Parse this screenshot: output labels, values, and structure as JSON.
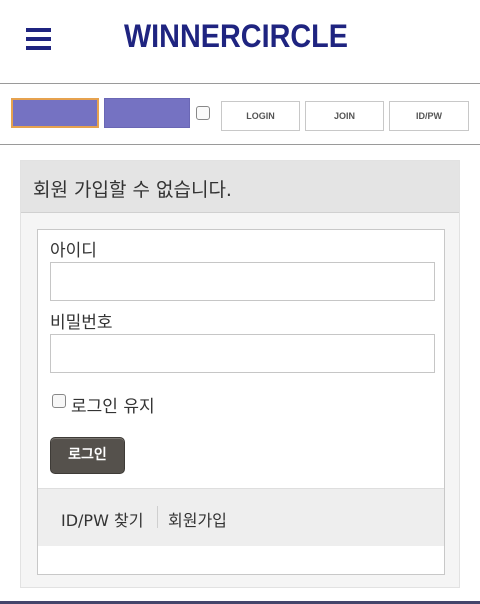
{
  "header": {
    "logo": "WINNERCIRCLE",
    "menu_icon": "hamburger-menu-icon"
  },
  "login_bar": {
    "id_input_placeholder": "",
    "pw_input_placeholder": "",
    "login_label": "LOGIN",
    "join_label": "JOIN",
    "idpw_label": "ID/PW"
  },
  "notice": {
    "title": "회원 가입할 수 없습니다."
  },
  "login_form": {
    "id_label": "아이디",
    "id_value": "",
    "pw_label": "비밀번호",
    "pw_value": "",
    "keep_label": "로그인 유지",
    "submit_label": "로그인"
  },
  "links": {
    "find_idpw": "ID/PW 찾기",
    "signup": "회원가입"
  },
  "colors": {
    "brand": "#1f2480",
    "input_fill": "#7572c2",
    "focus_border": "#e6a24f",
    "button_dark": "#55514c"
  }
}
